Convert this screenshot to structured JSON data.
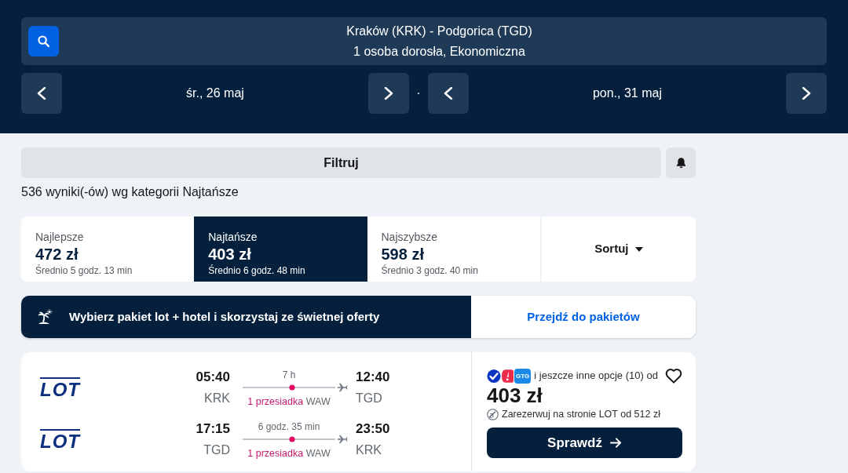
{
  "search": {
    "route": "Kraków (KRK) - Podgorica (TGD)",
    "passengers": "1 osoba dorosła, Ekonomiczna"
  },
  "dates": [
    {
      "label": "śr., 26 maj"
    },
    {
      "label": "pon., 31 maj"
    }
  ],
  "date_separator": "·",
  "filter": {
    "label": "Filtruj"
  },
  "results_summary": "536 wyniki(-ów) wg kategorii Najtańsze",
  "sort_tabs": [
    {
      "title": "Najlepsze",
      "price": "472 zł",
      "duration": "Średnio 5 godz. 13 min",
      "selected": false
    },
    {
      "title": "Najtańsze",
      "price": "403 zł",
      "duration": "Średnio 6 godz. 48 min",
      "selected": true
    },
    {
      "title": "Najszybsze",
      "price": "598 zł",
      "duration": "Średnio 3 godz. 40 min",
      "selected": false
    }
  ],
  "sort_button": "Sortuj",
  "promo": {
    "text": "Wybierz pakiet lot + hotel i skorzystaj ze świetnej oferty",
    "link": "Przejdź do pakietów"
  },
  "results": [
    {
      "legs": [
        {
          "airline_logo": "LOT",
          "depart_time": "05:40",
          "depart_airport": "KRK",
          "duration": "7 h",
          "stops": "1 przesiadka",
          "stop_airport": "WAW",
          "arrive_time": "12:40",
          "arrive_airport": "TGD"
        },
        {
          "airline_logo": "LOT",
          "depart_time": "17:15",
          "depart_airport": "TGD",
          "duration": "6 godz. 35 min",
          "stops": "1 przesiadka",
          "stop_airport": "WAW",
          "arrive_time": "23:50",
          "arrive_airport": "KRK"
        }
      ],
      "provider_badge": "GTG",
      "options_text": "i jeszcze inne opcje (10) od",
      "price": "403 zł",
      "direct_offer": "Zarezerwuj na stronie LOT od 512 zł",
      "button": "Sprawdź",
      "favorite": false
    }
  ]
}
